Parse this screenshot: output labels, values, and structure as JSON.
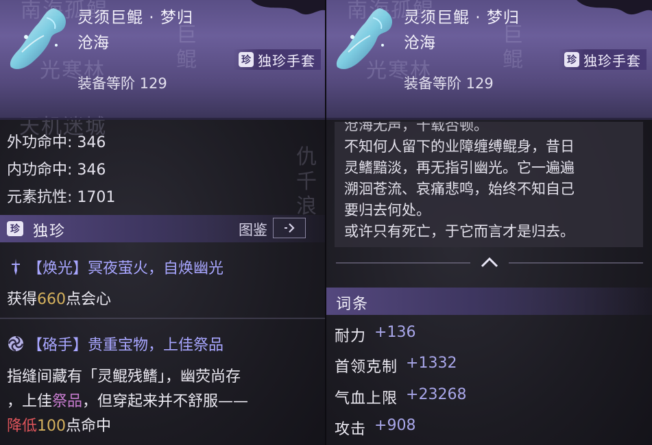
{
  "item": {
    "name": "灵须巨鲲 · 梦归",
    "subname": "沧海",
    "rarity_seal": "珍",
    "rarity_label": "独珍手套",
    "tier": "装备等阶 129"
  },
  "background_text": {
    "left_top": "南海孤鲲",
    "left_mid": "光寒林",
    "left_city": "天机迷城",
    "left_vertical_a": "巨鲲",
    "left_vertical_b": "仇千浪",
    "right_top": "南海孤鲲",
    "right_mid": "光寒林",
    "right_vertical_a": "巨鲲"
  },
  "stats": [
    {
      "label": "外功命中",
      "value": "346",
      "text": "外功命中: 346"
    },
    {
      "label": "内功命中",
      "value": "346",
      "text": "内功命中: 346"
    },
    {
      "label": "元素抗性",
      "value": "1701",
      "text": "元素抗性: 1701"
    }
  ],
  "unique_section": {
    "seal": "珍",
    "title": "独珍",
    "link_label": "图鉴"
  },
  "effects": [
    {
      "icon": "sword-icon",
      "title": "【焕光】冥夜萤火，自焕幽光",
      "desc_prefix": "获得",
      "desc_value": "660",
      "desc_suffix": "点会心"
    },
    {
      "icon": "swirl-icon",
      "title": "【硌手】贵重宝物，上佳祭品",
      "line1": "指缝间藏有「灵鲲残鳍」，幽荧尚存",
      "line2_a": "，上佳",
      "line2_hl": "祭品",
      "line2_b": "，但穿起来并不舒服——",
      "line3_red": "降低",
      "line3_value": "100",
      "line3_suffix": "点命中"
    }
  ],
  "lore": {
    "lines": [
      "沧海无声，千载否顿。",
      "不知何人留下的业障缠缚鲲身，昔日",
      "灵鳍黯淡，再无指引幽光。它一遍遍",
      "溯洄苍流、哀痛悲鸣，始终不知自己",
      "要归去何处。",
      "或许只有死亡，于它而言才是归去。"
    ]
  },
  "attributes_section": {
    "title": "词条",
    "rows": [
      {
        "name": "耐力",
        "value": "+136"
      },
      {
        "name": "首领克制",
        "value": "+1332"
      },
      {
        "name": "气血上限",
        "value": "+23268"
      },
      {
        "name": "攻击",
        "value": "+908"
      }
    ]
  },
  "colors": {
    "header_purple": "#6b5e9a",
    "effect_title": "#a8a6ff",
    "highlight_gold": "#d6b25e",
    "highlight_purple": "#c77ccf",
    "highlight_red": "#e0555b",
    "attribute_value": "#a9a7ea"
  }
}
